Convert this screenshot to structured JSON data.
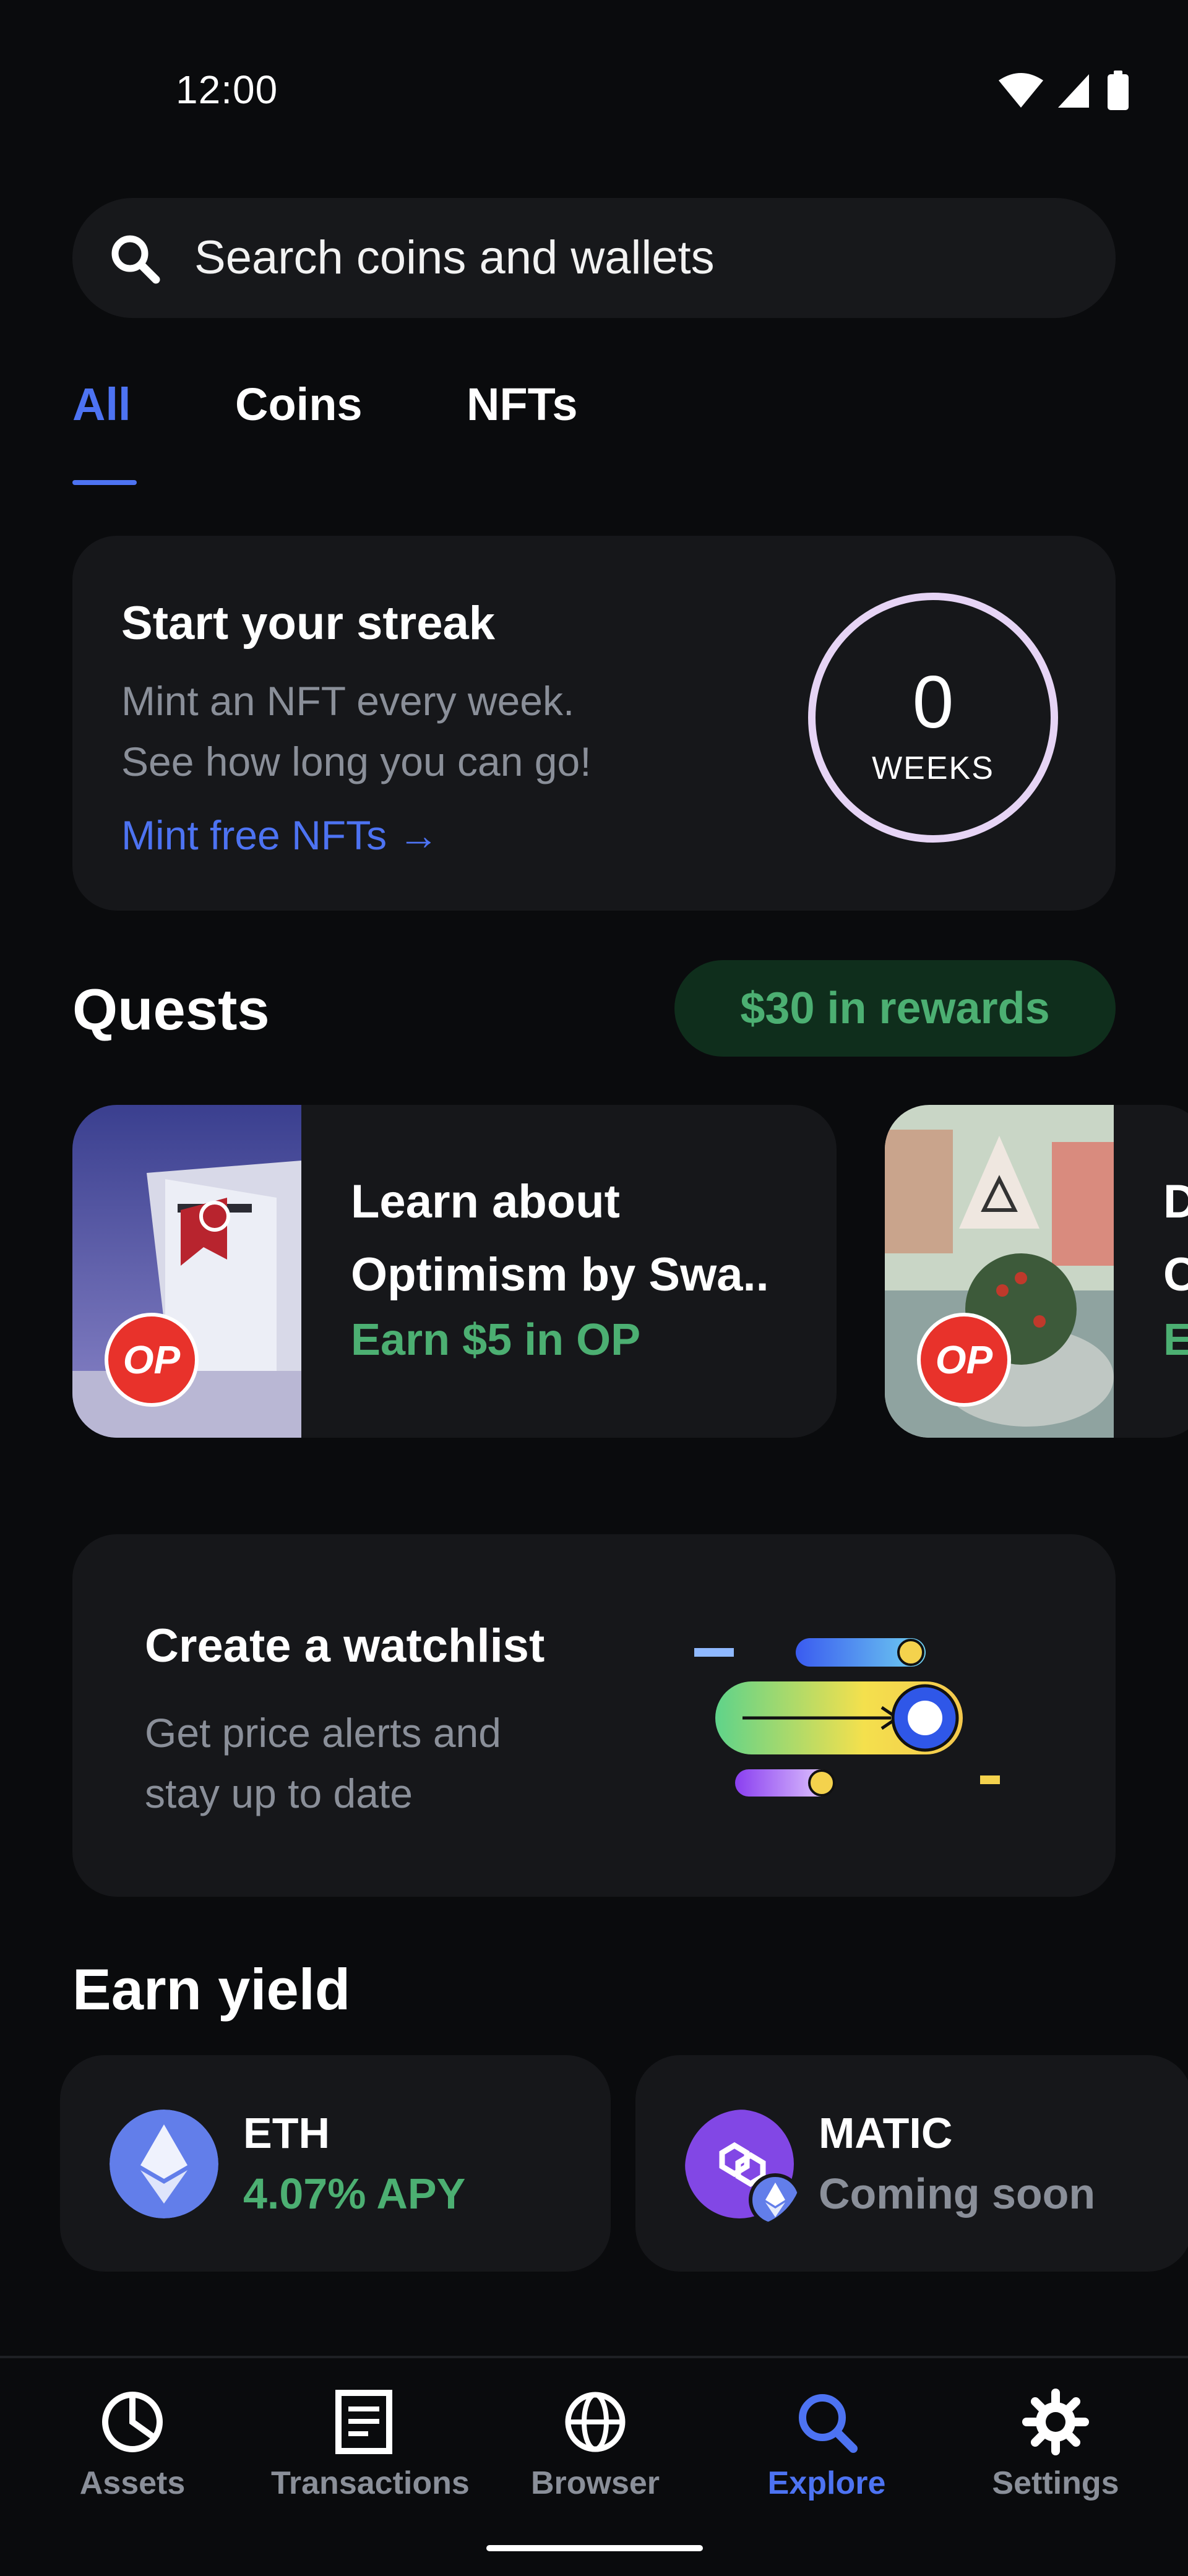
{
  "status_bar": {
    "time": "12:00"
  },
  "search": {
    "placeholder": "Search coins and wallets"
  },
  "tabs": [
    {
      "label": "All",
      "active": true
    },
    {
      "label": "Coins",
      "active": false
    },
    {
      "label": "NFTs",
      "active": false
    }
  ],
  "streak": {
    "title": "Start your streak",
    "description_line1": "Mint an NFT every week.",
    "description_line2": "See how long you can go!",
    "link": "Mint free NFTs →",
    "count": "0",
    "unit": "WEEKS"
  },
  "quests": {
    "title": "Quests",
    "rewards_badge": "$30 in rewards",
    "items": [
      {
        "title_line1": "Learn about",
        "title_line2": "Optimism by Swa..",
        "reward": "Earn $5 in OP",
        "badge": "OP"
      },
      {
        "title_line1": "D",
        "title_line2": "C",
        "reward": "E",
        "badge": "OP"
      }
    ]
  },
  "watchlist": {
    "title": "Create a watchlist",
    "description_line1": "Get price alerts and",
    "description_line2": "stay up to date"
  },
  "earn_yield": {
    "title": "Earn yield",
    "items": [
      {
        "name": "ETH",
        "sub": "4.07% APY",
        "icon": "ethereum-icon"
      },
      {
        "name": "MATIC",
        "sub": "Coming soon",
        "icon": "polygon-icon"
      }
    ]
  },
  "bottom_nav": [
    {
      "label": "Assets",
      "icon": "pie-chart-icon",
      "active": false
    },
    {
      "label": "Transactions",
      "icon": "document-icon",
      "active": false
    },
    {
      "label": "Browser",
      "icon": "globe-icon",
      "active": false
    },
    {
      "label": "Explore",
      "icon": "search-icon",
      "active": true
    },
    {
      "label": "Settings",
      "icon": "gear-icon",
      "active": false
    }
  ],
  "colors": {
    "background": "#0a0b0d",
    "card": "#16171a",
    "accent_blue": "#4d73f2",
    "reward_green": "#4caf72",
    "muted_text": "#8a8f99"
  }
}
